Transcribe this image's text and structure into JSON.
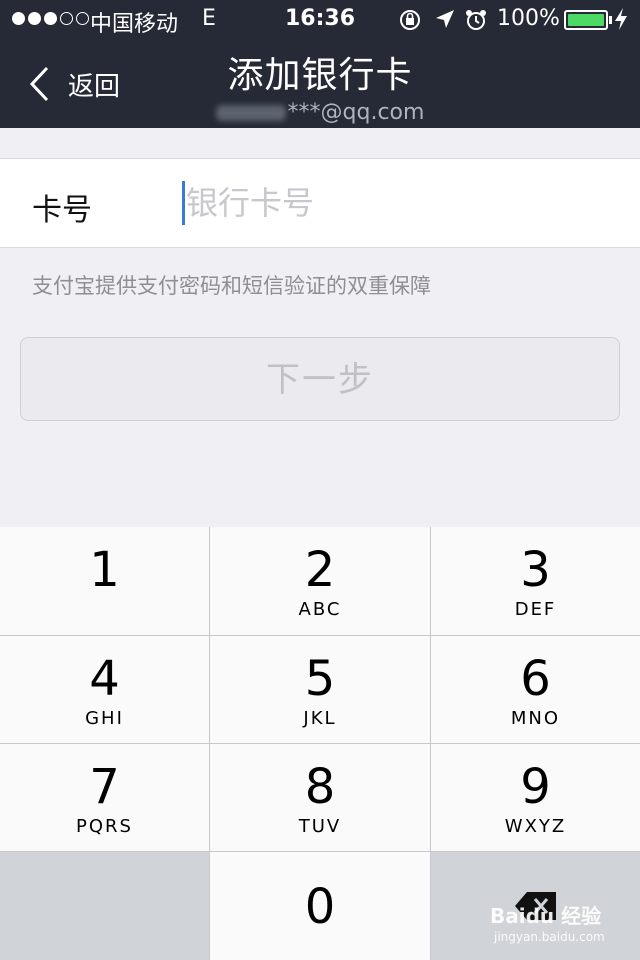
{
  "status_bar": {
    "signal_dots": 5,
    "signal_filled": 3,
    "carrier": "中国移动",
    "network": "E",
    "time": "16:36",
    "battery_text": "100%",
    "battery_level": 1.0,
    "battery_color": "#4cd964"
  },
  "nav": {
    "back_label": "返回",
    "title": "添加银行卡",
    "account": "***@qq.com"
  },
  "form": {
    "card_label": "卡号",
    "card_placeholder": "银行卡号",
    "hint": "支付宝提供支付密码和短信验证的双重保障",
    "next_button": "下一步"
  },
  "keypad": {
    "keys": [
      {
        "num": "1",
        "letters": ""
      },
      {
        "num": "2",
        "letters": "ABC"
      },
      {
        "num": "3",
        "letters": "DEF"
      },
      {
        "num": "4",
        "letters": "GHI"
      },
      {
        "num": "5",
        "letters": "JKL"
      },
      {
        "num": "6",
        "letters": "MNO"
      },
      {
        "num": "7",
        "letters": "PQRS"
      },
      {
        "num": "8",
        "letters": "TUV"
      },
      {
        "num": "9",
        "letters": "WXYZ"
      },
      {
        "num": "0",
        "letters": ""
      }
    ]
  },
  "watermark": {
    "brand": "Baidu 经验",
    "url": "jingyan.baidu.com"
  },
  "colors": {
    "nav_bg": "#252a36",
    "page_bg": "#efeff4",
    "caret": "#3a7bd5"
  }
}
